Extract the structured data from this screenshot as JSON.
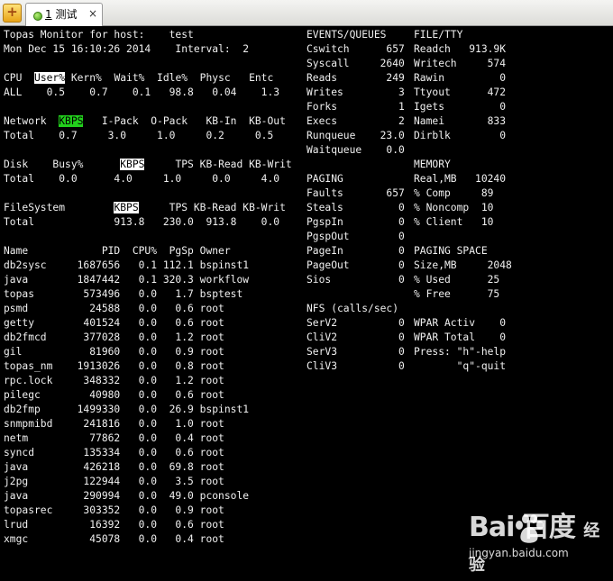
{
  "tab": {
    "new_tab": "+",
    "number": "1",
    "title": " 测试",
    "close": "×"
  },
  "header": {
    "host_line": "Topas Monitor for host:    test",
    "date_line": "Mon Dec 15 16:10:26 2014    Interval:  2"
  },
  "cpu": {
    "label": "CPU",
    "user": "User%",
    "cols": " Kern%  Wait%  Idle%  Physc   Entc",
    "row": "ALL    0.5    0.7    0.1   98.8   0.04    1.3"
  },
  "network": {
    "label": "Network  ",
    "kbps": "KBPS",
    "cols": "   I-Pack  O-Pack   KB-In  KB-Out",
    "row": "Total    0.7     3.0     1.0     0.2     0.5"
  },
  "disk": {
    "label": "Disk    Busy%      ",
    "kbps": "KBPS",
    "cols": "     TPS KB-Read KB-Writ",
    "row": "Total    0.0      4.0     1.0     0.0     4.0"
  },
  "filesystem": {
    "label": "FileSystem        ",
    "kbps": "KBPS",
    "cols": "     TPS KB-Read KB-Writ",
    "row": "Total             913.8   230.0  913.8    0.0"
  },
  "processes": {
    "header": "Name            PID  CPU%  PgSp Owner",
    "rows": [
      "db2sysc     1687656   0.1 112.1 bspinst1",
      "java        1847442   0.1 320.3 workflow",
      "topas        573496   0.0   1.7 bsptest",
      "psmd          24588   0.0   0.6 root",
      "getty        401524   0.0   0.6 root",
      "db2fmcd      377028   0.0   1.2 root",
      "gil           81960   0.0   0.9 root",
      "topas_nm    1913026   0.0   0.8 root",
      "rpc.lock     348332   0.0   1.2 root",
      "pilegc        40980   0.0   0.6 root",
      "db2fmp      1499330   0.0  26.9 bspinst1",
      "snmpmibd     241816   0.0   1.0 root",
      "netm          77862   0.0   0.4 root",
      "syncd        135334   0.0   0.6 root",
      "java         426218   0.0  69.8 root",
      "j2pg         122944   0.0   3.5 root",
      "java         290994   0.0  49.0 pconsole",
      "topasrec     303352   0.0   0.9 root",
      "lrud          16392   0.0   0.6 root",
      "xmgc          45078   0.0   0.4 root"
    ]
  },
  "events": {
    "header": "EVENTS/QUEUES",
    "rows": [
      "Cswitch      657",
      "Syscall     2640",
      "Reads        249",
      "Writes         3",
      "Forks          1",
      "Execs          2",
      "Runqueue    23.0",
      "Waitqueue    0.0"
    ]
  },
  "filetty": {
    "header": "FILE/TTY",
    "rows": [
      "Readch   913.9K",
      "Writech     574",
      "Rawin         0",
      "Ttyout      472",
      "Igets         0",
      "Namei       833",
      "Dirblk        0"
    ]
  },
  "paging": {
    "header": "PAGING",
    "rows": [
      "Faults       657",
      "Steals         0",
      "PgspIn         0",
      "PgspOut        0",
      "PageIn         0",
      "PageOut        0",
      "Sios           0"
    ]
  },
  "memory": {
    "header": "MEMORY",
    "rows": [
      "Real,MB   10240",
      "% Comp     89",
      "% Noncomp  10",
      "% Client   10"
    ]
  },
  "paging_space": {
    "header": "PAGING SPACE",
    "rows": [
      "Size,MB     2048",
      "% Used      25",
      "% Free      75"
    ]
  },
  "nfs": {
    "header": "NFS (calls/sec)",
    "rows": [
      "SerV2          0",
      "CliV2          0",
      "SerV3          0",
      "CliV3          0"
    ]
  },
  "wpar": {
    "rows": [
      "WPAR Activ    0",
      "WPAR Total    0",
      "Press: \"h\"-help",
      "       \"q\"-quit"
    ]
  },
  "watermark": {
    "logo": "Bai  百度",
    "tag": "经验",
    "url": "jingyan.baidu.com"
  }
}
